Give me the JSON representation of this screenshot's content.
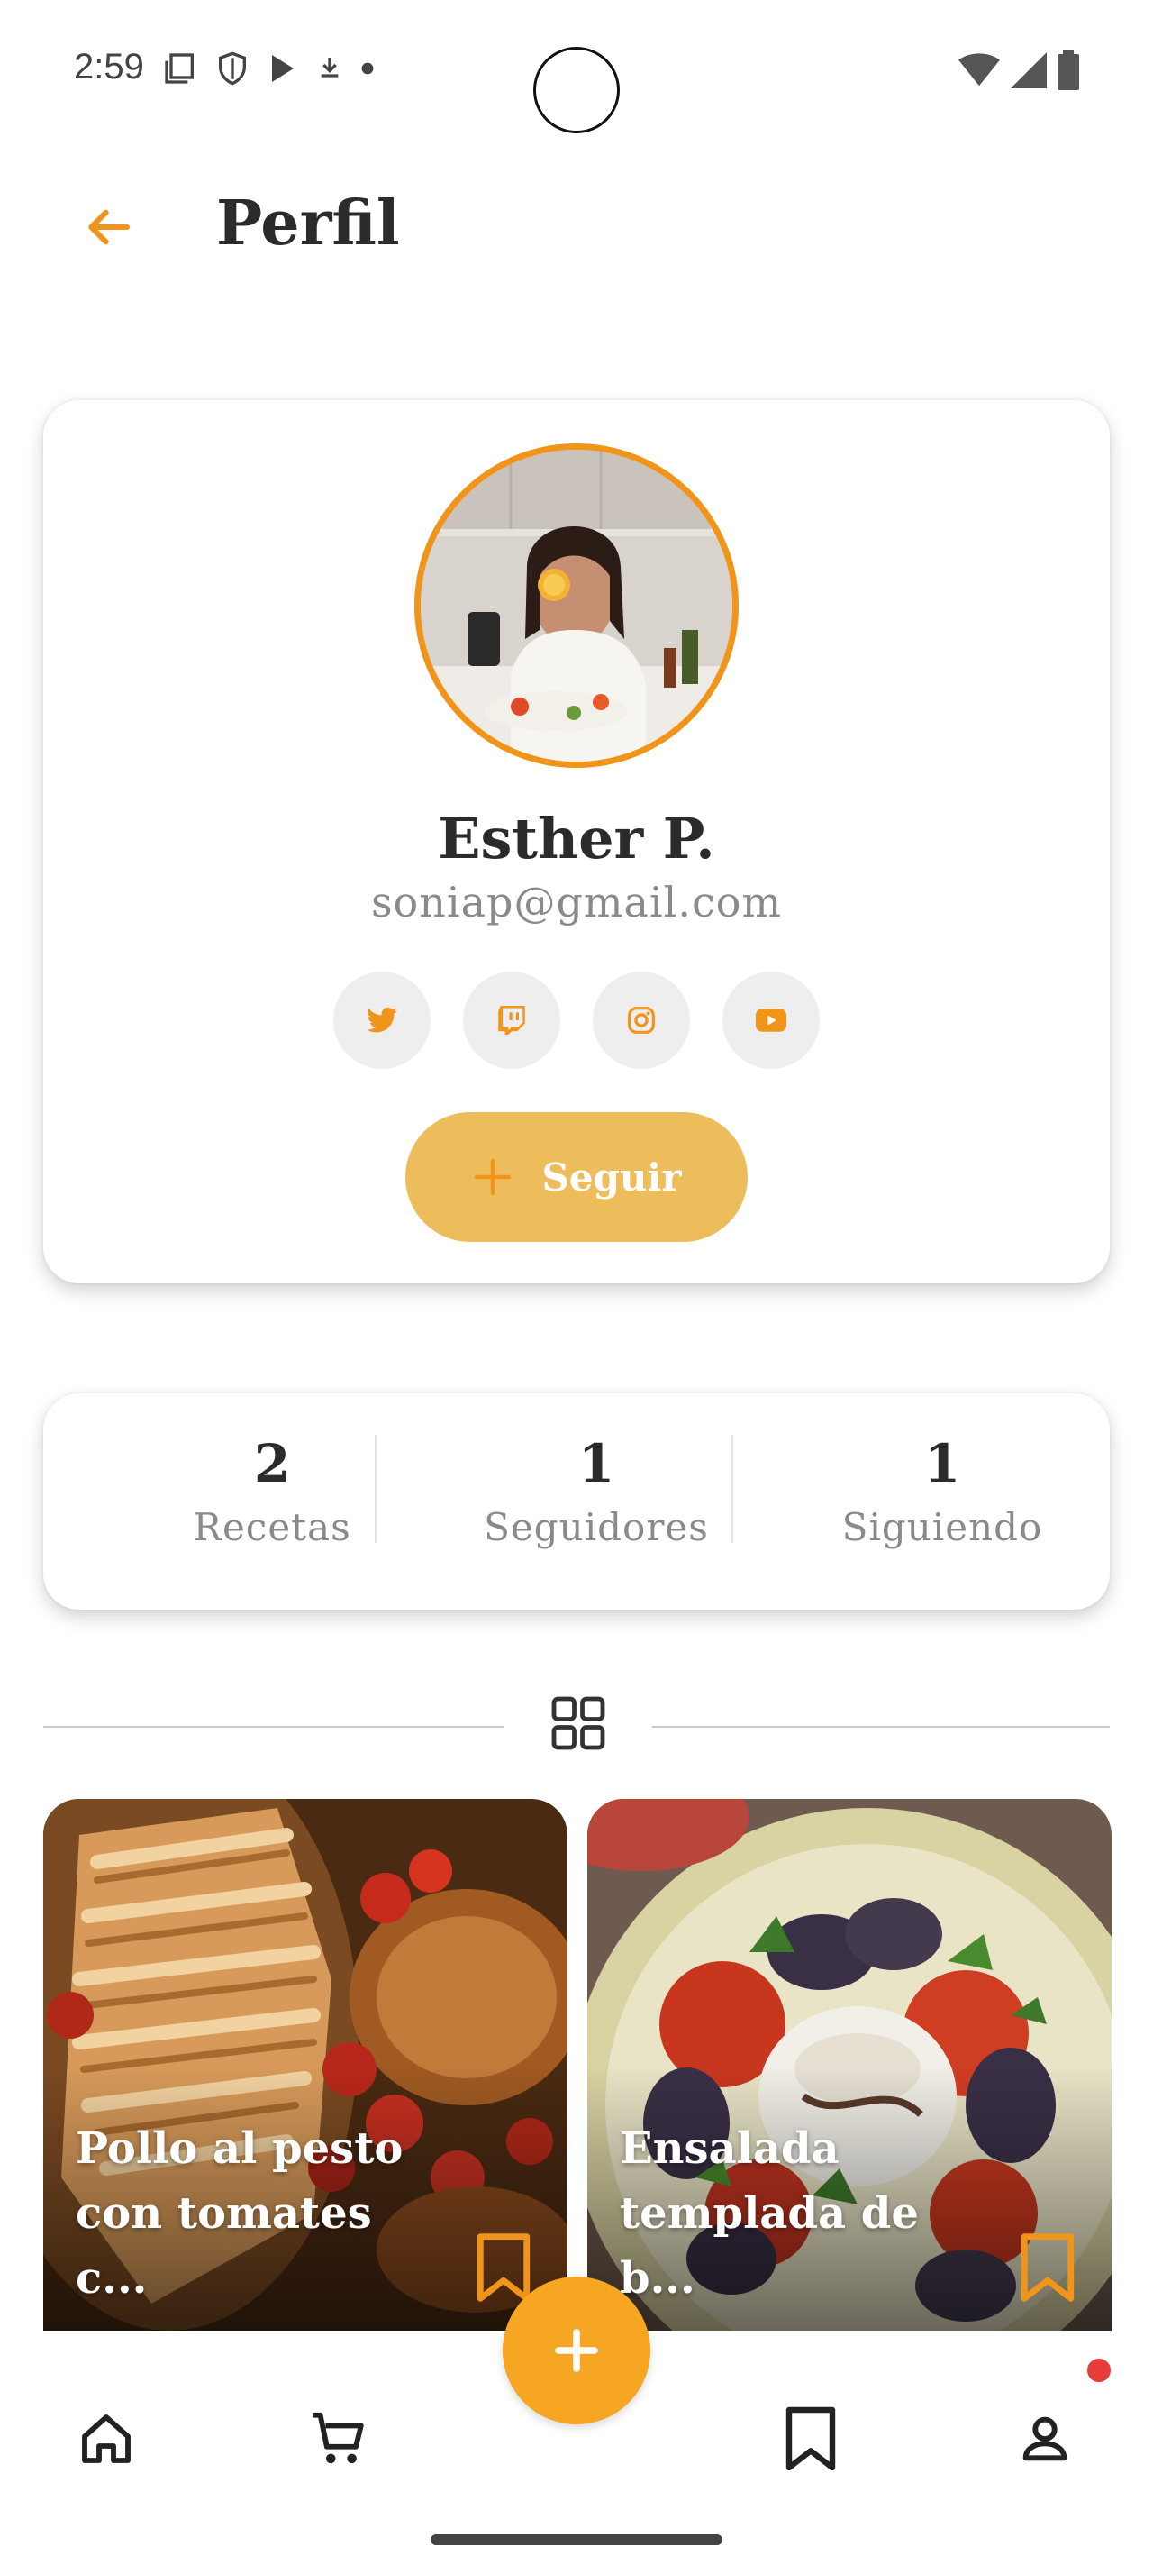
{
  "status_bar": {
    "time": "2:59",
    "left_icons": [
      "notes-icon",
      "shield-icon",
      "play-store-icon",
      "download-icon",
      "dot-icon"
    ],
    "right_icons": [
      "wifi-icon",
      "signal-icon",
      "battery-icon"
    ]
  },
  "header": {
    "title": "Perfil",
    "back_icon": "arrow-left-icon"
  },
  "profile": {
    "name": "Esther P.",
    "email": "soniap@gmail.com",
    "social": [
      "twitter-icon",
      "twitch-icon",
      "instagram-icon",
      "youtube-icon"
    ],
    "follow_label": "Seguir"
  },
  "stats": [
    {
      "value": "2",
      "label": "Recetas"
    },
    {
      "value": "1",
      "label": "Seguidores"
    },
    {
      "value": "1",
      "label": "Siguiendo"
    }
  ],
  "recipes": [
    {
      "title": "Pollo al pesto con tomates c..."
    },
    {
      "title": "Ensalada templada de b..."
    }
  ],
  "bottom_nav": [
    "home-icon",
    "cart-icon",
    "add-icon",
    "bookmark-icon",
    "profile-icon"
  ],
  "colors": {
    "accent": "#f0951a",
    "follow_button": "#edbd5c",
    "fab": "#f6a623",
    "notification": "#ea3b3b"
  }
}
